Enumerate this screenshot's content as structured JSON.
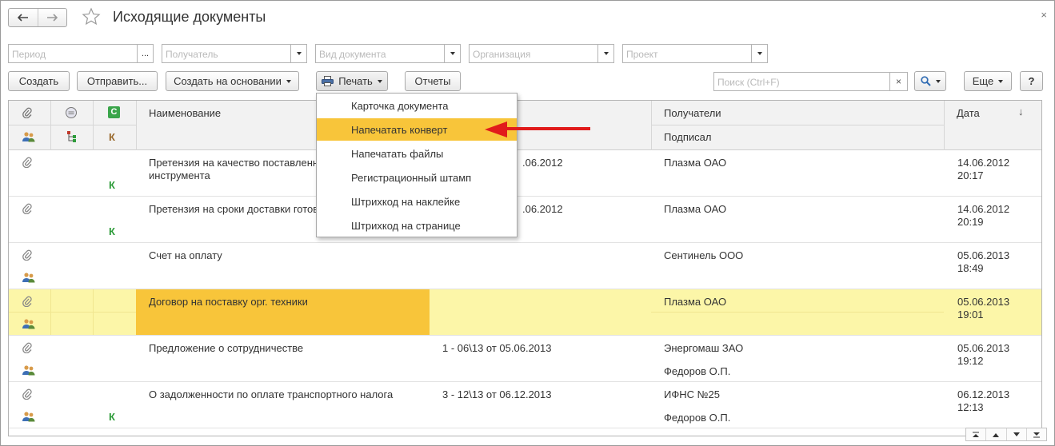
{
  "window": {
    "title": "Исходящие документы",
    "close_glyph": "×"
  },
  "filters": [
    {
      "placeholder": "Период",
      "button": "..."
    },
    {
      "placeholder": "Получатель"
    },
    {
      "placeholder": "Вид документа"
    },
    {
      "placeholder": "Организация"
    },
    {
      "placeholder": "Проект"
    }
  ],
  "toolbar": {
    "create": "Создать",
    "send": "Отправить...",
    "create_based_on": "Создать на основании",
    "print": "Печать",
    "reports": "Отчеты",
    "search_placeholder": "Поиск (Ctrl+F)",
    "search_clear": "×",
    "more": "Еще",
    "help": "?"
  },
  "print_menu": {
    "items": [
      "Карточка документа",
      "Напечатать конверт",
      "Напечатать файлы",
      "Регистрационный штамп",
      "Штрихкод на наклейке",
      "Штрихкод на странице"
    ],
    "highlighted_index": 1
  },
  "table": {
    "headers": {
      "c_icon": "С",
      "k_icon": "К",
      "name": "Наименование",
      "recipients": "Получатели",
      "signed": "Подписал",
      "date": "Дата",
      "sort_indicator": "↓"
    },
    "rows": [
      {
        "name_line1": "Претензия на качество поставленн",
        "name_line2": "инструмента",
        "number": ".06.2012",
        "recipient": "Плазма ОАО",
        "signed": "",
        "date": "14.06.2012",
        "time": "20:17",
        "k": "К",
        "group_icon": false
      },
      {
        "name_line1": "Претензия на сроки доставки готов",
        "name_line2": "",
        "number": ".06.2012",
        "recipient": "Плазма ОАО",
        "signed": "",
        "date": "14.06.2012",
        "time": "20:19",
        "k": "К",
        "group_icon": false
      },
      {
        "name_line1": "Счет на оплату",
        "name_line2": "",
        "number": "",
        "recipient": "Сентинель ООО",
        "signed": "",
        "date": "05.06.2013",
        "time": "18:49",
        "k": "",
        "group_icon": true
      },
      {
        "name_line1": "Договор на поставку орг. техники",
        "name_line2": "",
        "number": "",
        "recipient": "Плазма ОАО",
        "signed": "",
        "date": "05.06.2013",
        "time": "19:01",
        "k": "",
        "group_icon": true
      },
      {
        "name_line1": "Предложение о сотрудничестве",
        "name_line2": "",
        "number": "1 - 06\\13 от 05.06.2013",
        "recipient": "Энергомаш ЗАО",
        "signed": "Федоров О.П.",
        "date": "05.06.2013",
        "time": "19:12",
        "k": "",
        "group_icon": true
      },
      {
        "name_line1": "О задолженности по оплате транспортного налога",
        "name_line2": "",
        "number": "3 - 12\\13 от 06.12.2013",
        "recipient": "ИФНС №25",
        "signed": "Федоров О.П.",
        "date": "06.12.2013",
        "time": "12:13",
        "k": "К",
        "group_icon": true
      }
    ],
    "selected_index": 3
  },
  "colors": {
    "accent_yellow": "#f8c53a",
    "selected_row": "#fcf6a8",
    "k_green": "#2e9c3a",
    "arrow_red": "#e11b1b"
  }
}
